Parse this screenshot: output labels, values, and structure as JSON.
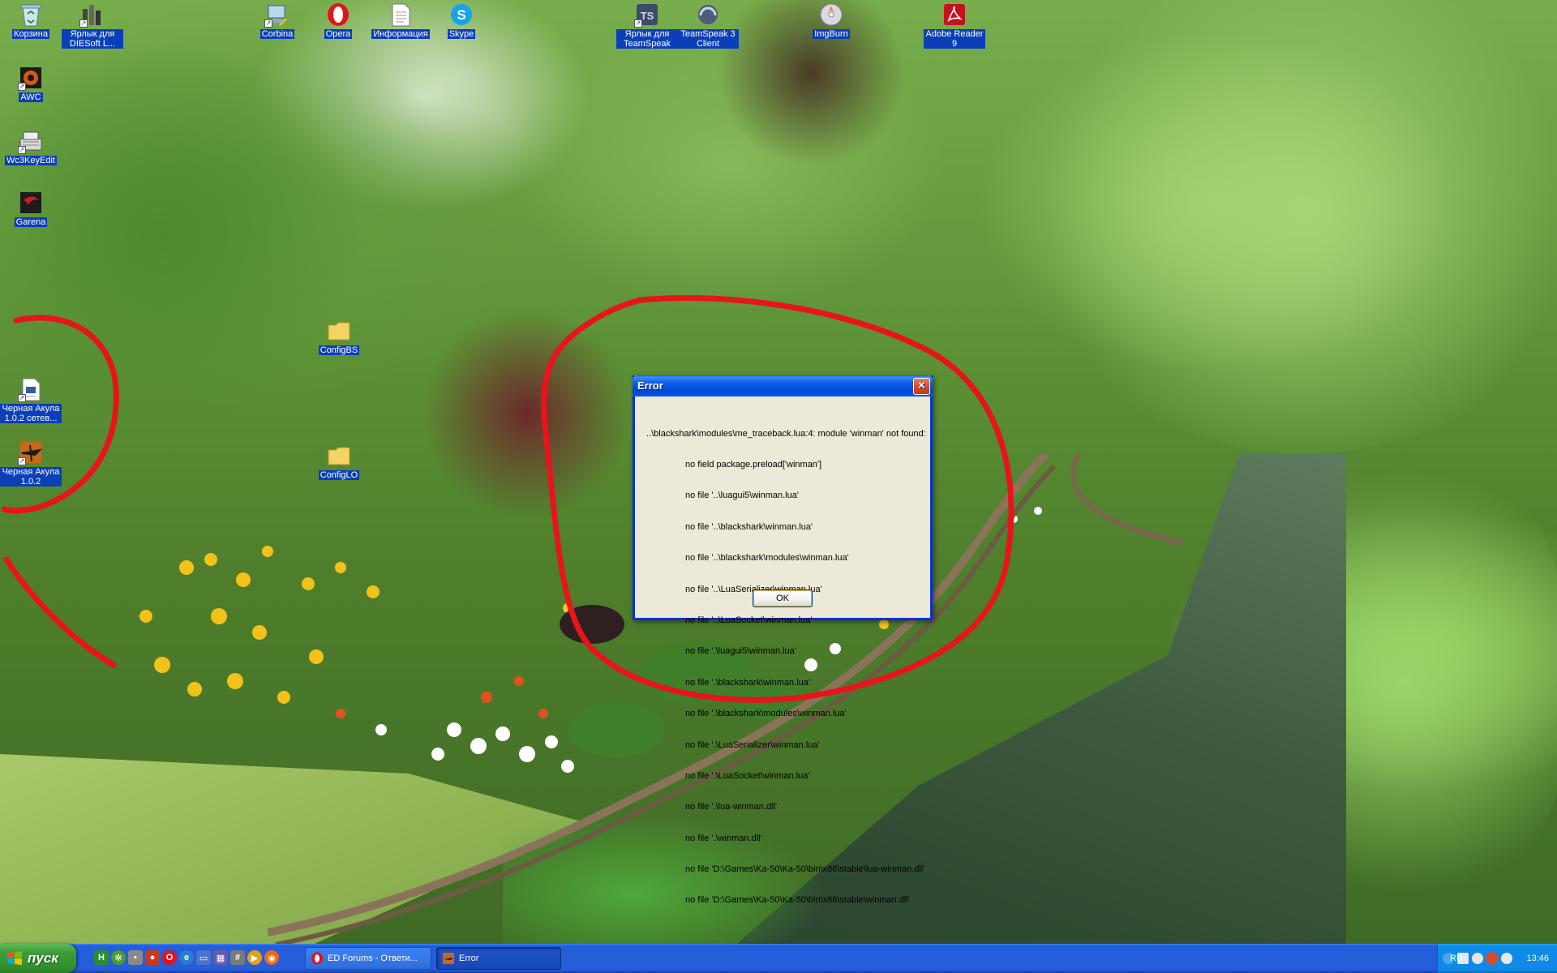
{
  "desktop": {
    "icons": [
      {
        "label": "Корзина",
        "icon": "recycle-bin-icon"
      },
      {
        "label": "Ярлык для DIESoft L...",
        "icon": "diesoft-icon"
      },
      {
        "label": "Corbina",
        "icon": "network-connection-icon"
      },
      {
        "label": "Opera",
        "icon": "opera-icon"
      },
      {
        "label": "Информация",
        "icon": "document-icon"
      },
      {
        "label": "Skype",
        "icon": "skype-icon"
      },
      {
        "label": "Ярлык для TeamSpeak",
        "icon": "teamspeak-icon"
      },
      {
        "label": "TeamSpeak 3 Client",
        "icon": "teamspeak3-icon"
      },
      {
        "label": "ImgBurn",
        "icon": "imgburn-icon"
      },
      {
        "label": "Adobe Reader 9",
        "icon": "adobe-reader-icon"
      },
      {
        "label": "AWC",
        "icon": "awc-icon"
      },
      {
        "label": "Wc3KeyEdit",
        "icon": "keyboard-icon"
      },
      {
        "label": "Garena",
        "icon": "garena-icon"
      },
      {
        "label": "ConfigBS",
        "icon": "folder-icon"
      },
      {
        "label": "ConfigLO",
        "icon": "folder-icon"
      },
      {
        "label": "Черная Акула 1.0.2 сетев...",
        "icon": "black-shark-network-icon"
      },
      {
        "label": "Черная Акула 1.0.2",
        "icon": "black-shark-icon"
      }
    ]
  },
  "dialog": {
    "title": "Error",
    "close_label": "×",
    "message_first": "..\\blackshark\\modules\\me_traceback.lua:4: module 'winman' not found:",
    "message_lines": [
      "no field package.preload['winman']",
      "no file '..\\luagui5\\winman.lua'",
      "no file '..\\blackshark\\winman.lua'",
      "no file '..\\blackshark\\modules\\winman.lua'",
      "no file '..\\LuaSerializer\\winman.lua'",
      "no file '..\\LuaSocket\\winman.lua'",
      "no file '.\\luagui5\\winman.lua'",
      "no file '.\\blackshark\\winman.lua'",
      "no file '.\\blackshark\\modules\\winman.lua'",
      "no file '.\\LuaSerializer\\winman.lua'",
      "no file '.\\LuaSocket\\winman.lua'",
      "no file '.\\lua-winman.dll'",
      "no file '.\\winman.dll'",
      "no file 'D:\\Games\\Ka-50\\Ka-50\\bin\\x86\\stable\\lua-winman.dll'",
      "no file 'D:\\Games\\Ka-50\\Ka-50\\bin\\x86\\stable\\winman.dll'"
    ],
    "ok_label": "OK"
  },
  "taskbar": {
    "start_label": "пуск",
    "tasks": [
      {
        "label": "ED Forums - Ответи...",
        "icon": "opera-icon"
      },
      {
        "label": "Error",
        "icon": "black-shark-icon"
      }
    ],
    "tray": {
      "language": "RU",
      "clock": "13:46"
    }
  },
  "colors": {
    "annotation_red": "#e8141c",
    "xp_blue": "#245edb",
    "icon_label_bg": "#0b3fb8"
  }
}
